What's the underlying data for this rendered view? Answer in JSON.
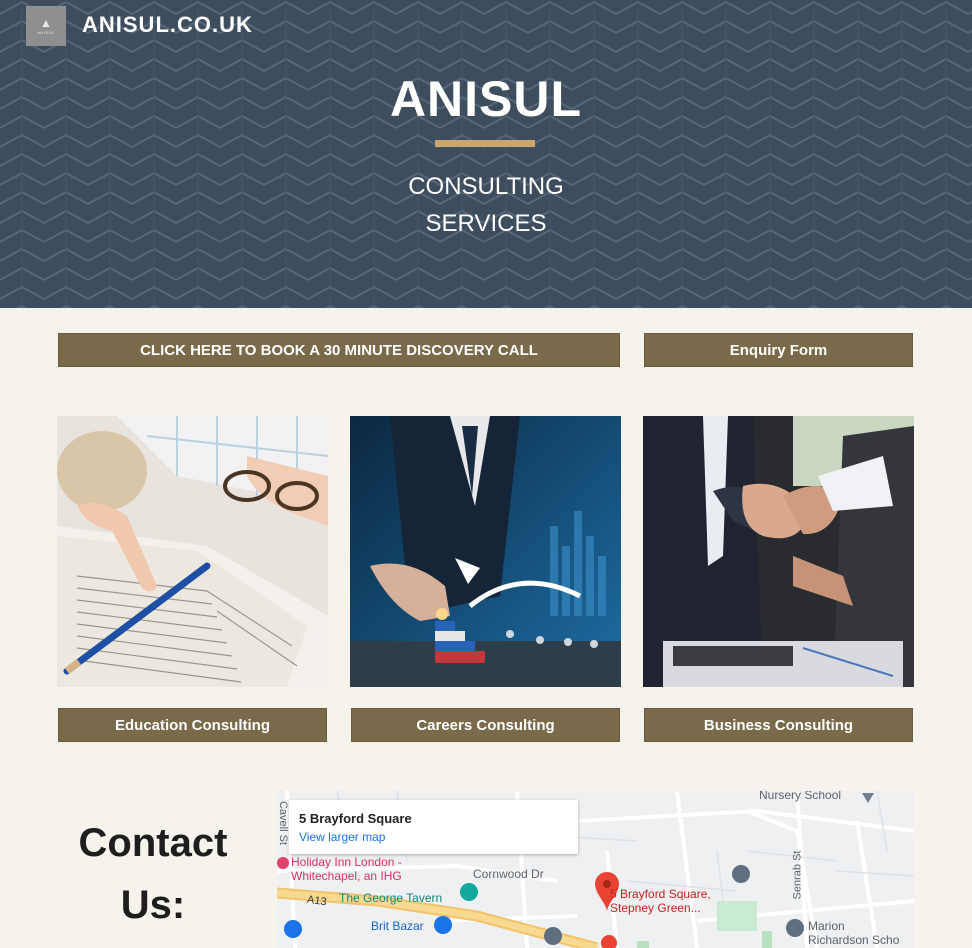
{
  "header": {
    "logo_text": "ANISUL",
    "site_name": "ANISUL.CO.UK",
    "title": "ANISUL",
    "subtitle_line1": "CONSULTING",
    "subtitle_line2": "SERVICES"
  },
  "actions": {
    "discovery_call": "CLICK HERE TO BOOK A 30 MINUTE DISCOVERY CALL",
    "enquiry_form": "Enquiry Form"
  },
  "services": [
    {
      "label": "Education Consulting",
      "image": "book-study-photo"
    },
    {
      "label": "Careers Consulting",
      "image": "career-steps-photo"
    },
    {
      "label": "Business Consulting",
      "image": "handshake-photo"
    }
  ],
  "contact": {
    "title_line1": "Contact",
    "title_line2": "Us:"
  },
  "map": {
    "card_title": "5 Brayford Square",
    "card_link": "View larger map",
    "labels": {
      "nursery": "Nursery School",
      "cavell": "Cavell St",
      "holiday_inn_1": "Holiday Inn London -",
      "holiday_inn_2": "Whitechapel, an IHG",
      "cornwood": "Cornwood Dr",
      "george": "The George Tavern",
      "a13": "A13",
      "brit_bazar": "Brit Bazar",
      "pin_1": "5 Brayford Square,",
      "pin_2": "Stepney Green...",
      "senrab": "Senrab St",
      "marion_1": "Marion",
      "marion_2": "Richardson Scho"
    }
  },
  "colors": {
    "hero_bg": "#3e4d5d",
    "accent_rule": "#c8a66d",
    "button_bg": "#7a6a4a",
    "page_bg": "#f6f2ec"
  }
}
